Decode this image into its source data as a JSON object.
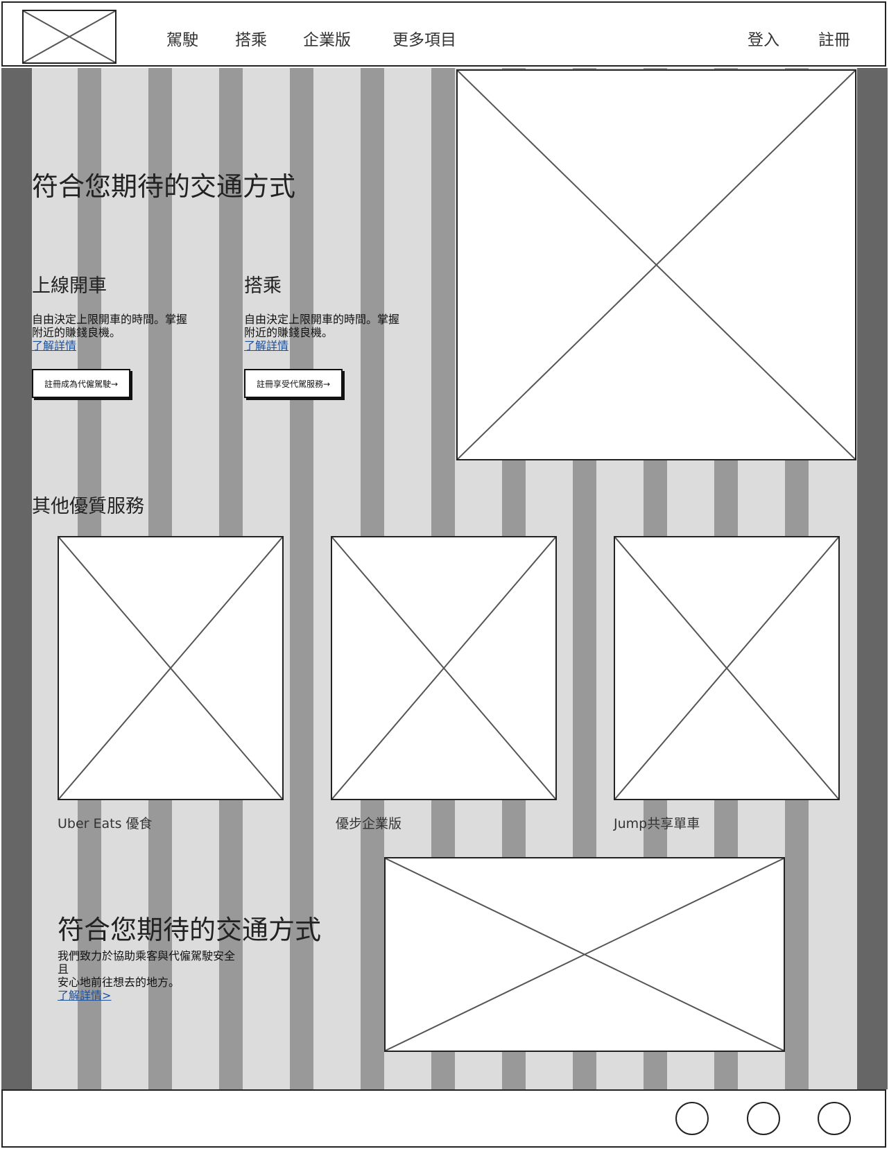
{
  "header": {
    "nav": [
      "駕駛",
      "搭乘",
      "企業版",
      "更多項目"
    ],
    "login": "登入",
    "signup": "註冊"
  },
  "hero": {
    "title": "符合您期待的交通方式",
    "drive": {
      "heading": "上線開車",
      "line1": "自由決定上限開車的時間。掌握",
      "line2": "附近的賺錢良機。",
      "link": "了解詳情",
      "button": "註冊成為代僱駕駛→"
    },
    "ride": {
      "heading": "搭乘",
      "line1": "自由決定上限開車的時間。掌握",
      "line2": "附近的賺錢良機。",
      "link": "了解詳情",
      "button": "註冊享受代駕服務→"
    }
  },
  "services": {
    "heading": "其他優質服務",
    "items": [
      "Uber Eats 優食",
      "優步企業版",
      "Jump共享單車"
    ]
  },
  "about": {
    "title": "符合您期待的交通方式",
    "line1": "我們致力於協助乘客與代僱駕駛安全",
    "line2": "且",
    "line3": "安心地前往想去的地方。",
    "link": "了解詳情>"
  }
}
